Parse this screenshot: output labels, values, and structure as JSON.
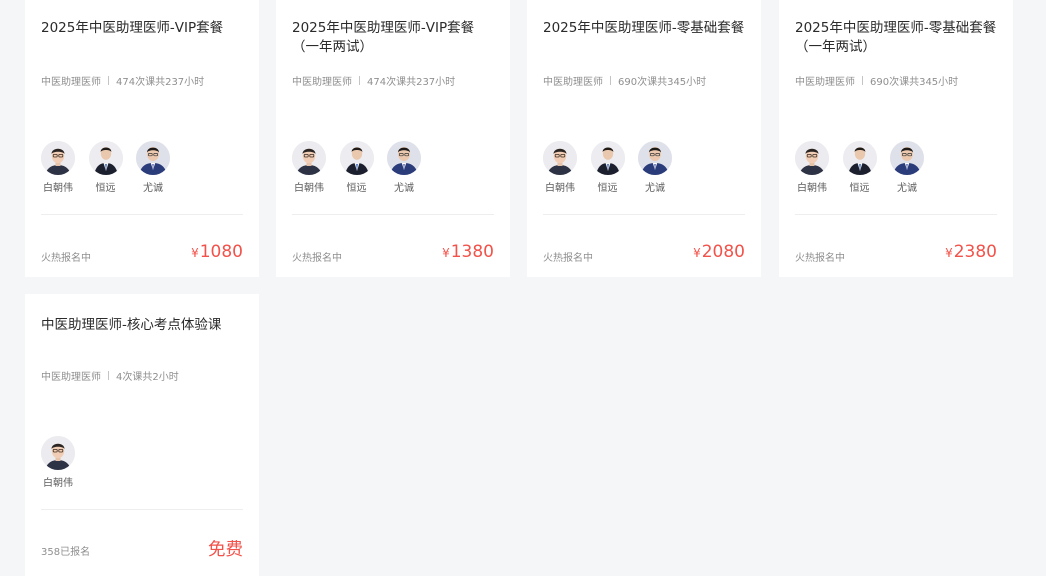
{
  "teachers": {
    "bai": "白朝伟",
    "heng": "恒远",
    "you": "尤诚"
  },
  "cards": [
    {
      "title": "2025年中医助理医师-VIP套餐",
      "category": "中医助理医师",
      "lessons": "474次课共237小时",
      "status": "火热报名中",
      "currency": "¥",
      "price": "1080"
    },
    {
      "title": "2025年中医助理医师-VIP套餐（一年两试）",
      "category": "中医助理医师",
      "lessons": "474次课共237小时",
      "status": "火热报名中",
      "currency": "¥",
      "price": "1380"
    },
    {
      "title": "2025年中医助理医师-零基础套餐",
      "category": "中医助理医师",
      "lessons": "690次课共345小时",
      "status": "火热报名中",
      "currency": "¥",
      "price": "2080"
    },
    {
      "title": "2025年中医助理医师-零基础套餐（一年两试）",
      "category": "中医助理医师",
      "lessons": "690次课共345小时",
      "status": "火热报名中",
      "currency": "¥",
      "price": "2380"
    },
    {
      "title": "中医助理医师-核心考点体验课",
      "category": "中医助理医师",
      "lessons": "4次课共2小时",
      "status": "358已报名",
      "price": "免费"
    }
  ],
  "colors": {
    "background": "#f5f6f8",
    "price": "#f2524a"
  },
  "icons": {
    "avatar": "teacher-avatar-icon"
  }
}
